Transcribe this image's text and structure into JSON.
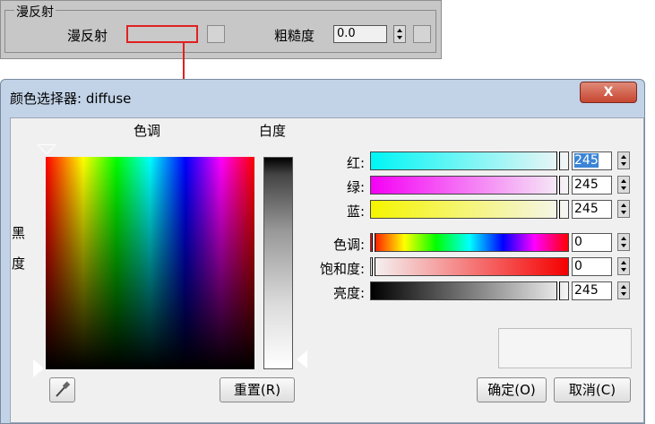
{
  "rollout": {
    "section_title": "漫反射",
    "diffuse_label": "漫反射",
    "roughness_label": "粗糙度",
    "roughness_value": "0.0"
  },
  "dialog": {
    "title": "颜色选择器: diffuse",
    "close_label": "X",
    "hue_label": "色调",
    "whiteness_label": "白度",
    "blackness_label": "黑度",
    "sliders": [
      {
        "label": "红:",
        "value": "245"
      },
      {
        "label": "绿:",
        "value": "245"
      },
      {
        "label": "蓝:",
        "value": "245"
      },
      {
        "label": "色调:",
        "value": "0"
      },
      {
        "label": "饱和度:",
        "value": "0"
      },
      {
        "label": "亮度:",
        "value": "245"
      }
    ],
    "reset_label": "重置(R)",
    "ok_label": "确定(O)",
    "cancel_label": "取消(C)",
    "colors": {
      "current": "#f5f5f5",
      "accent": "#e02020",
      "title_bar": "#c2d3e8"
    }
  }
}
